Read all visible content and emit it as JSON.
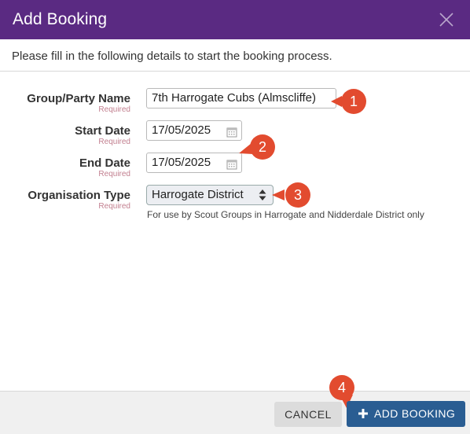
{
  "dialog": {
    "title": "Add Booking",
    "close_icon": "close-icon",
    "intro": "Please fill in the following details to start the booking process."
  },
  "form": {
    "required_text": "Required",
    "group_name": {
      "label": "Group/Party Name",
      "value": "7th Harrogate Cubs (Almscliffe)"
    },
    "start_date": {
      "label": "Start Date",
      "value": "17/05/2025",
      "icon": "calendar-icon"
    },
    "end_date": {
      "label": "End Date",
      "value": "17/05/2025",
      "icon": "calendar-icon"
    },
    "organisation_type": {
      "label": "Organisation Type",
      "selected": "Harrogate District",
      "help": "For use by Scout Groups in Harrogate and Nidderdale District only"
    }
  },
  "badges": [
    "1",
    "2",
    "3",
    "4"
  ],
  "footer": {
    "cancel_label": "CANCEL",
    "add_label": "ADD BOOKING",
    "add_icon": "plus-icon"
  },
  "colors": {
    "header": "#5a2a82",
    "primary_button": "#2a5d92",
    "badge": "#e24b2f",
    "required": "#c27f8f"
  }
}
